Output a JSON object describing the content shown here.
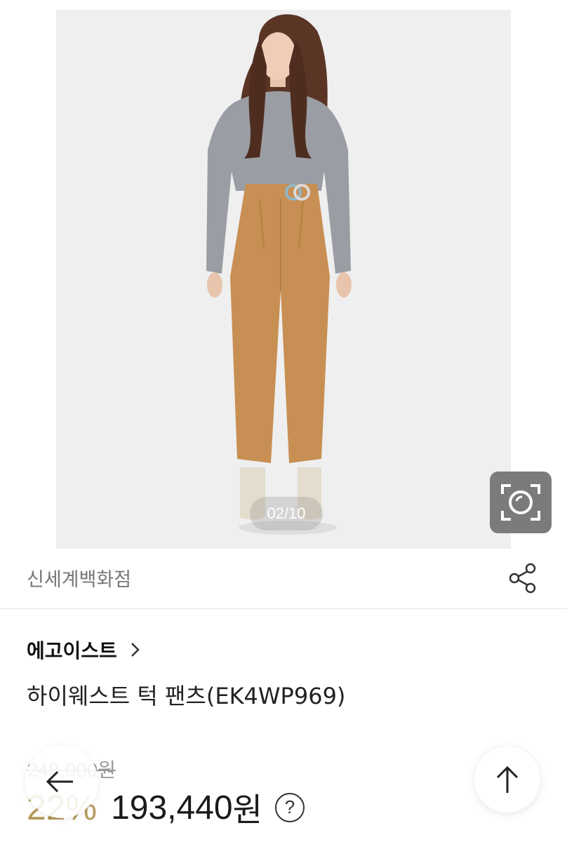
{
  "gallery": {
    "counter": "02/10"
  },
  "store": {
    "name": "신세계백화점"
  },
  "product": {
    "brand": "에고이스트",
    "title": "하이웨스트 턱 팬츠(EK4WP969)",
    "original_price": "248,000원",
    "discount": "22%",
    "sale_price": "193,440",
    "sale_unit": "원",
    "help_symbol": "?"
  },
  "icons": {
    "lens": "camera-lens-search-icon",
    "share": "share-icon",
    "brand_chevron": "chevron-right-icon",
    "back": "arrow-left-icon",
    "top": "arrow-up-icon",
    "help": "question-circle-icon"
  },
  "colors": {
    "discount": "#b49a5c",
    "lens_button": "#7b7b7b",
    "photo_background": "#eeeeee"
  }
}
